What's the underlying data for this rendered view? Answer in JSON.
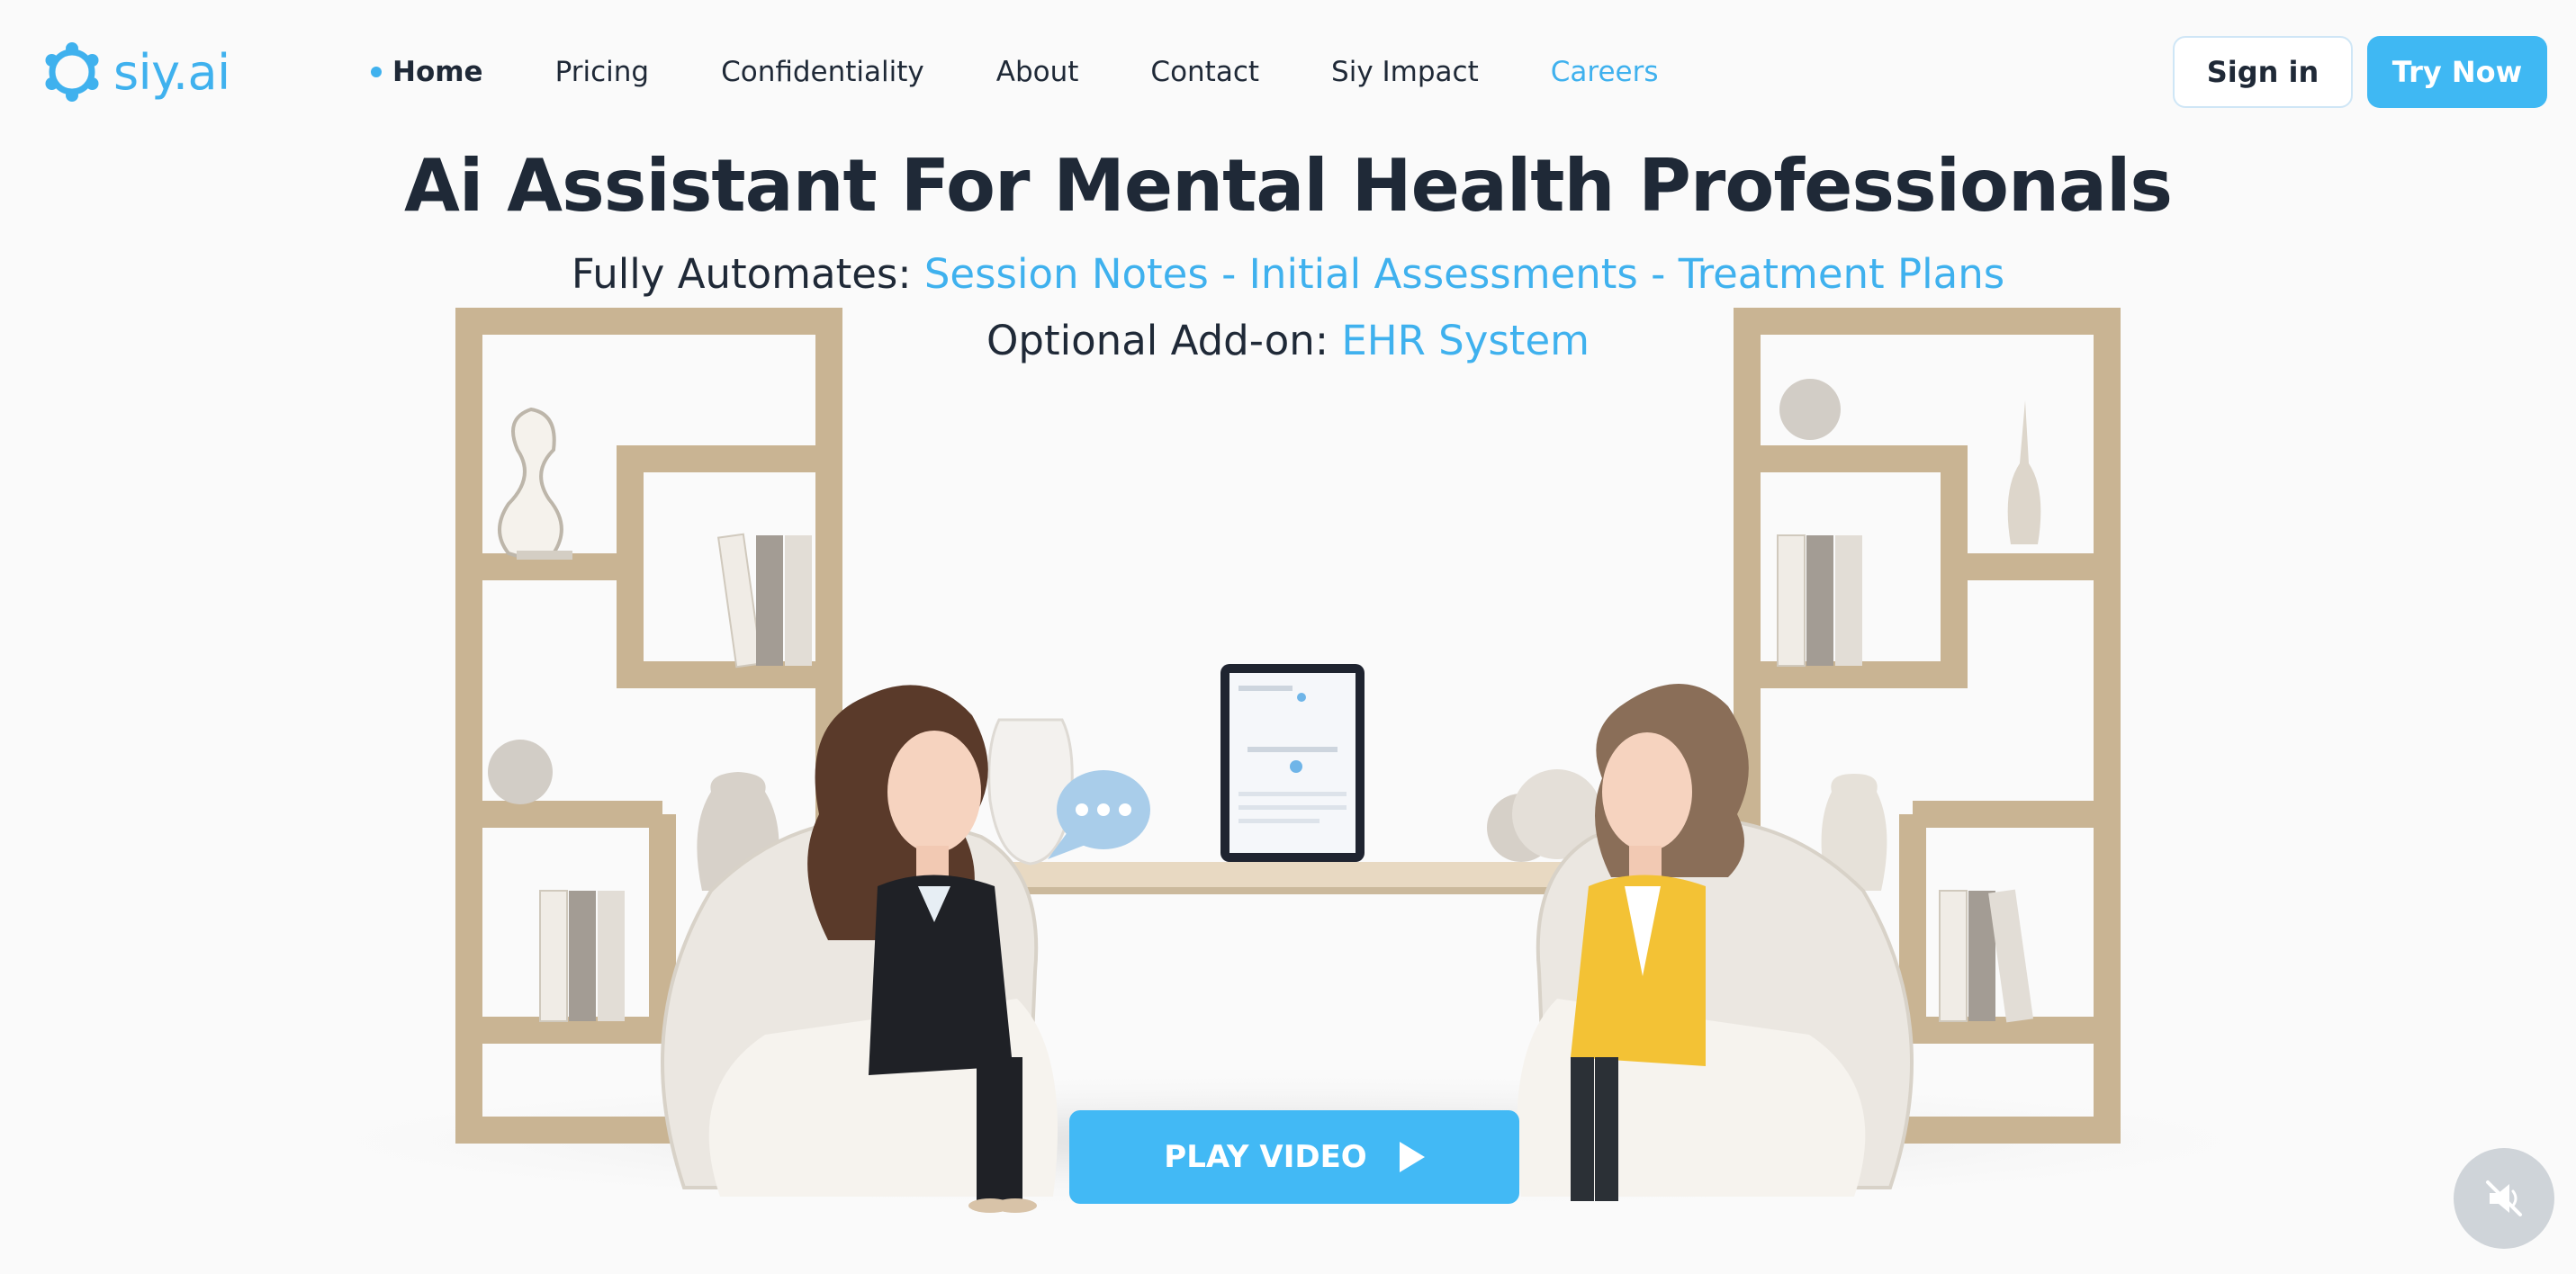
{
  "brand": {
    "name": "siy.ai",
    "color": "#3fb1ee"
  },
  "nav": {
    "items": [
      {
        "label": "Home",
        "active": true
      },
      {
        "label": "Pricing"
      },
      {
        "label": "Confidentiality"
      },
      {
        "label": "About"
      },
      {
        "label": "Contact"
      },
      {
        "label": "Siy Impact"
      },
      {
        "label": "Careers",
        "accent": true
      }
    ],
    "signin_label": "Sign in",
    "try_label": "Try Now"
  },
  "hero": {
    "title": "Ai Assistant For Mental Health Professionals",
    "line1_prefix": "Fully Automates:",
    "line1_items": "Session Notes - Initial Assessments - Treatment Plans",
    "line2_prefix": "Optional Add-on:",
    "line2_item": "EHR System"
  },
  "video": {
    "play_label": "PLAY VIDEO",
    "play_icon": "play-icon",
    "mute_icon": "muted-speaker-icon"
  },
  "colors": {
    "accent": "#3fb1ee",
    "button": "#42b9f5",
    "text": "#1f2937",
    "shelf": "#c9b493"
  }
}
